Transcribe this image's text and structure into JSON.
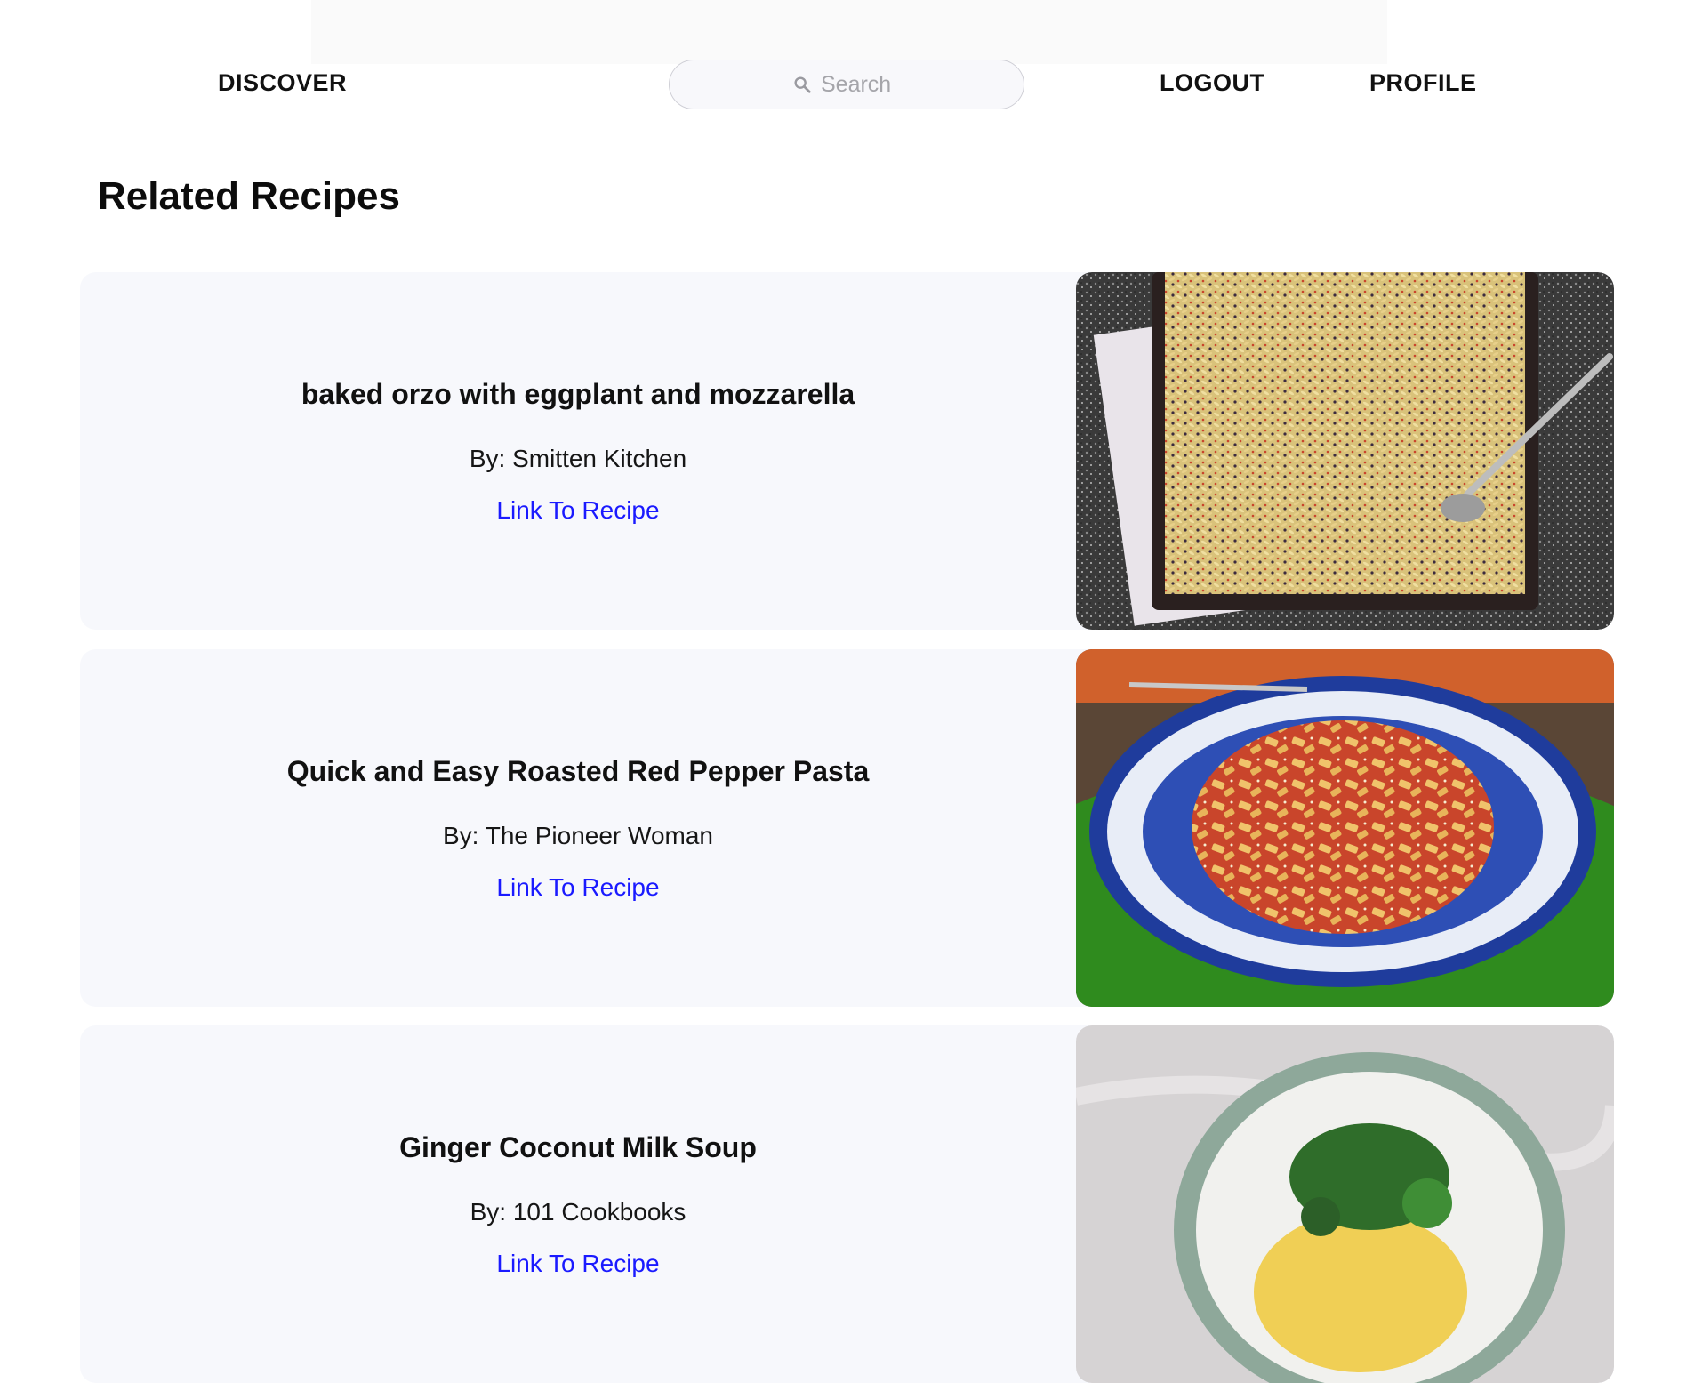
{
  "nav": {
    "discover": "DISCOVER",
    "logout": "LOGOUT",
    "profile": "PROFILE"
  },
  "search": {
    "placeholder": "Search",
    "icon": "search-icon"
  },
  "page_title": "Related Recipes",
  "recipes": [
    {
      "title": "baked orzo with eggplant and mozzarella",
      "author": "By: Smitten Kitchen",
      "link_label": "Link To Recipe",
      "image_subject": "baked orzo casserole in a dark square dish"
    },
    {
      "title": "Quick and Easy Roasted Red Pepper Pasta",
      "author": "By: The Pioneer Woman",
      "link_label": "Link To Recipe",
      "image_subject": "red pepper pasta in a blue patterned bowl on a green plate"
    },
    {
      "title": "Ginger Coconut Milk Soup",
      "author": "By: 101 Cookbooks",
      "link_label": "Link To Recipe",
      "image_subject": "noodles with greens on a decorative plate"
    }
  ],
  "colors": {
    "link": "#1a1aff",
    "card_bg": "#f7f8fc",
    "text": "#111111"
  }
}
